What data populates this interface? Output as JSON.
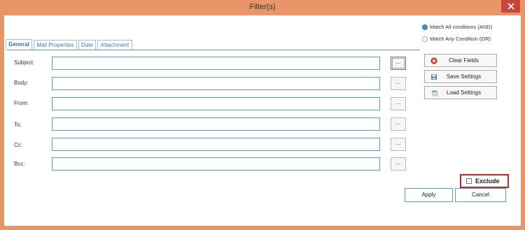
{
  "window": {
    "title": "Filter(s)",
    "close_icon": "close-icon"
  },
  "tabs": [
    {
      "label": "General"
    },
    {
      "label": "Mail Properties"
    },
    {
      "label": "Date"
    },
    {
      "label": "Attachment"
    }
  ],
  "fields": [
    {
      "label": "Subject:",
      "value": "",
      "browse": "..."
    },
    {
      "label": "Body:",
      "value": "",
      "browse": "..."
    },
    {
      "label": "From:",
      "value": "",
      "browse": "..."
    },
    {
      "label": "To:",
      "value": "",
      "browse": "..."
    },
    {
      "label": "Cc:",
      "value": "",
      "browse": "..."
    },
    {
      "label": "Bcc:",
      "value": "",
      "browse": "..."
    }
  ],
  "match": {
    "all": "Match All conditions (AND)",
    "any": "Match Any Condition (OR)",
    "selected": "all"
  },
  "side_buttons": {
    "clear": "Clear Fields",
    "save": "Save Settings",
    "load": "Load Settings"
  },
  "exclude": {
    "label": "Exclude",
    "checked": false
  },
  "actions": {
    "apply": "Apply",
    "cancel": "Cancel"
  },
  "colors": {
    "frame": "#e8956a",
    "close": "#c9463d",
    "accent": "#5a9ad0",
    "exclude_border": "#c02a2a"
  }
}
